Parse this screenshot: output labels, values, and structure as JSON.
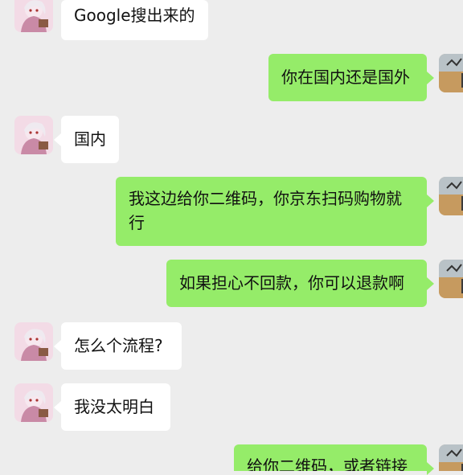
{
  "messages": [
    {
      "side": "incoming",
      "text": "Google搜出来的"
    },
    {
      "side": "outgoing",
      "text": "你在国内还是国外"
    },
    {
      "side": "incoming",
      "text": "国内"
    },
    {
      "side": "outgoing",
      "text": "我这边给你二维码，你京东扫码购物就行"
    },
    {
      "side": "outgoing",
      "text": "如果担心不回款，你可以退款啊"
    },
    {
      "side": "incoming",
      "text": "怎么个流程?"
    },
    {
      "side": "incoming",
      "text": "我没太明白"
    },
    {
      "side": "outgoing",
      "text": "给你二维码，或者链接"
    }
  ],
  "colors": {
    "background": "#ededed",
    "incoming_bubble": "#ffffff",
    "outgoing_bubble": "#95ec69"
  }
}
